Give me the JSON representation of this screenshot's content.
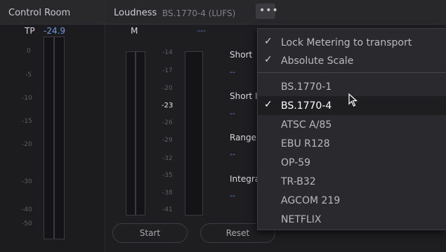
{
  "control_room": {
    "title": "Control Room",
    "tp_label": "TP",
    "tp_value": "-24.9",
    "scale": [
      "0",
      "-5",
      "-10",
      "-15",
      "-20",
      "-30",
      "-40",
      "-50"
    ]
  },
  "loudness": {
    "title": "Loudness",
    "standard": "BS.1770-4 (LUFS)",
    "more_icon": "•••",
    "m_label": "M",
    "m_value": "---",
    "scale": [
      "-14",
      "-17",
      "-20",
      "-23",
      "-26",
      "-29",
      "-32",
      "-35",
      "-38",
      "-41"
    ],
    "scale_active": "-23",
    "stats": [
      {
        "label": "Short",
        "value": "--"
      },
      {
        "label": "Short I",
        "value": "--"
      },
      {
        "label": "Range",
        "value": "--"
      },
      {
        "label": "Integra",
        "value": "--"
      }
    ],
    "start_button": "Start",
    "reset_button": "Reset"
  },
  "menu": {
    "options": [
      {
        "label": "Lock Metering to transport",
        "checked": true
      },
      {
        "label": "Absolute Scale",
        "checked": true
      }
    ],
    "standards": [
      {
        "label": "BS.1770-1",
        "checked": false
      },
      {
        "label": "BS.1770-4",
        "checked": true
      },
      {
        "label": "ATSC A/85",
        "checked": false
      },
      {
        "label": "EBU R128",
        "checked": false
      },
      {
        "label": "OP-59",
        "checked": false
      },
      {
        "label": "TR-B32",
        "checked": false
      },
      {
        "label": "AGCOM 219",
        "checked": false
      },
      {
        "label": "NETFLIX",
        "checked": false
      }
    ],
    "check_glyph": "✓"
  }
}
